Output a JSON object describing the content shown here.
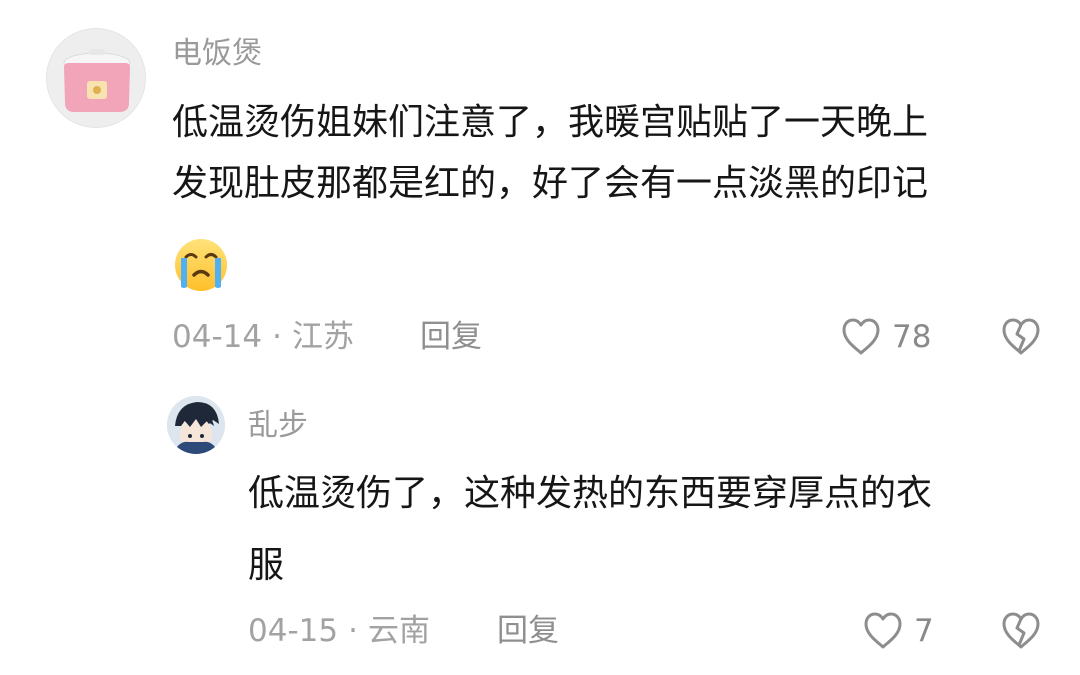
{
  "comments": [
    {
      "username": "电饭煲",
      "avatar_icon": "rice-cooker-icon",
      "text_lines": [
        "低温烫伤姐妹们注意了，我暖宫贴贴了一天晚上",
        "发现肚皮那都是红的，好了会有一点淡黑的印记"
      ],
      "emoji": "crying-face-emoji",
      "date": "04-14",
      "location": "江苏",
      "reply_label": "回复",
      "likes": "78",
      "reply": {
        "username": "乱步",
        "avatar_icon": "anime-avatar-icon",
        "text_lines": [
          "低温烫伤了，这种发热的东西要穿厚点的衣",
          "服"
        ],
        "date": "04-15",
        "location": "云南",
        "reply_label": "回复",
        "likes": "7"
      }
    }
  ],
  "separator": "·"
}
